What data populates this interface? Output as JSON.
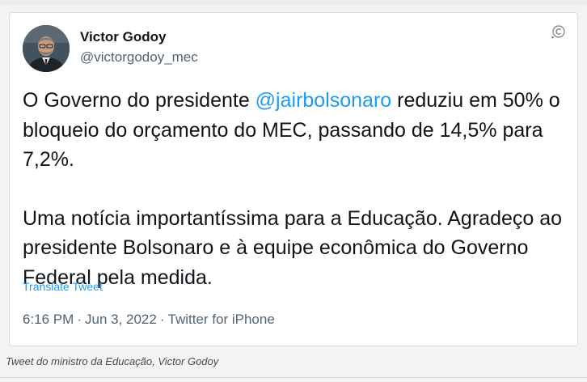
{
  "tweet": {
    "author": {
      "name": "Victor Godoy",
      "handle": "@victorgodoy_mec"
    },
    "text": {
      "p1_before": "O Governo do presidente ",
      "p1_mention": "@jairbolsonaro",
      "p1_after": " reduziu em 50% o bloqueio do orçamento do MEC, passando de 14,5% para 7,2%.",
      "p2": "Uma notícia importantíssima para a Educação. Agradeço ao presidente Bolsonaro e à equipe econômica do Governo Federal pela medida."
    },
    "translate_label": "Translate Tweet",
    "meta": {
      "time": "6:16 PM",
      "separator": "·",
      "date": "Jun 3, 2022",
      "source": "Twitter for iPhone"
    }
  },
  "caption": "Tweet do ministro da Educação, Victor Godoy",
  "colors": {
    "link": "#1d9bf0",
    "text": "#0f1419",
    "muted": "#536471"
  },
  "icons": {
    "corner": "copyright-icon"
  }
}
